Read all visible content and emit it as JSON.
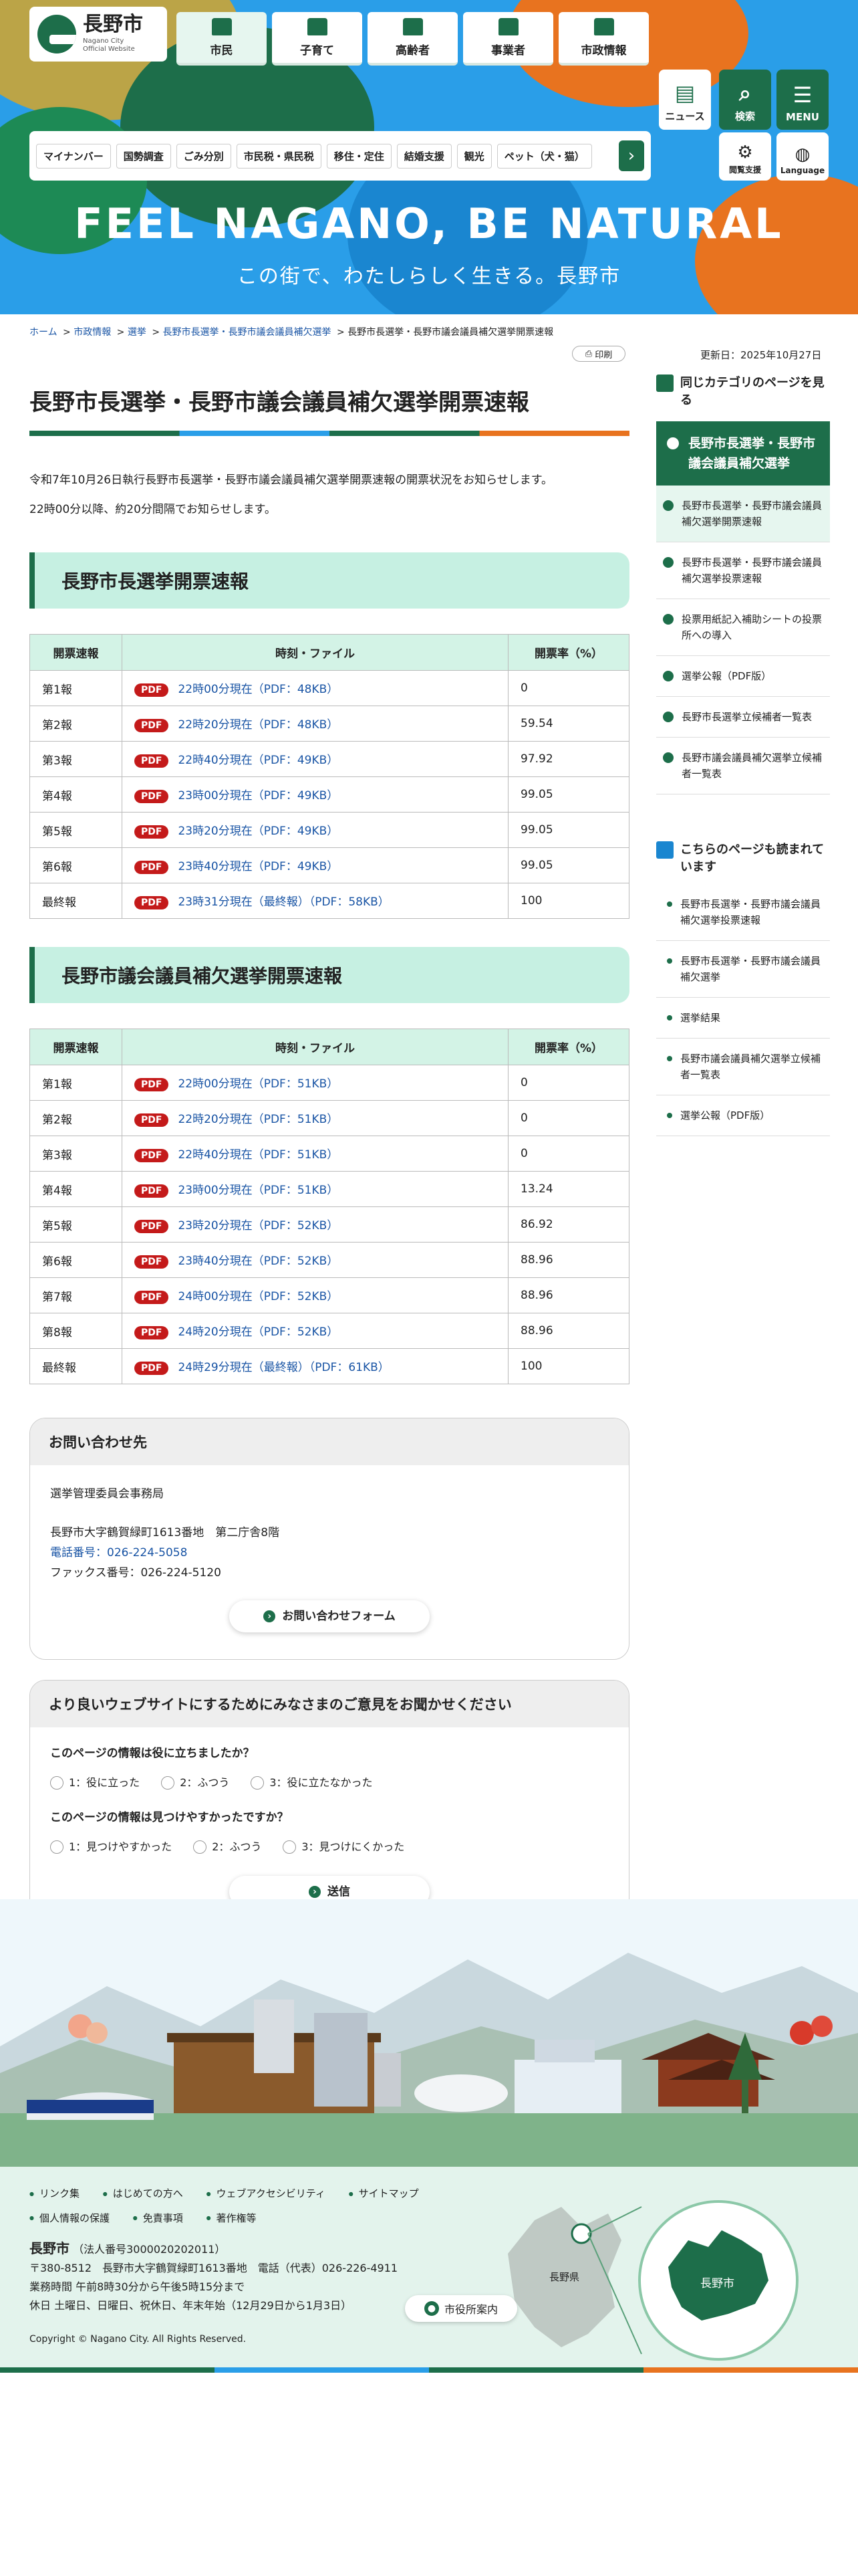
{
  "header": {
    "logo_jp": "長野市",
    "logo_en1": "Nagano City",
    "logo_en2": "Official Website",
    "nav": [
      {
        "label": "市民"
      },
      {
        "label": "子育て"
      },
      {
        "label": "高齢者"
      },
      {
        "label": "事業者"
      },
      {
        "label": "市政情報"
      }
    ],
    "tools": {
      "news": "ニュース",
      "search": "検索",
      "menu": "MENU",
      "browse": "閲覧支援",
      "language": "Language"
    },
    "tags": [
      "マイナンバー",
      "国勢調査",
      "ごみ分別",
      "市民税・県民税",
      "移住・定住",
      "結婚支援",
      "観光",
      "ペット（犬・猫）"
    ],
    "catch_en": "FEEL NAGANO, BE NATURAL",
    "catch_jp": "この街で、わたしらしく生きる。長野市"
  },
  "breadcrumb": {
    "items": [
      "ホーム",
      "市政情報",
      "選挙",
      "長野市長選挙・長野市議会議員補欠選挙"
    ],
    "current": "長野市長選挙・長野市議会議員補欠選挙開票速報"
  },
  "print_label": "印刷",
  "updated": "更新日：2025年10月27日",
  "page": {
    "title": "長野市長選挙・長野市議会議員補欠選挙開票速報",
    "lead1": "令和7年10月26日執行長野市長選挙・長野市議会議員補欠選挙開票速報の開票状況をお知らせします。",
    "lead2": "22時00分以降、約20分間隔でお知らせします。"
  },
  "table_headers": {
    "col1": "開票速報",
    "col2": "時刻・ファイル",
    "col3": "開票率（%）"
  },
  "pdf_badge": "PDF",
  "mayor": {
    "heading": "長野市長選挙開票速報",
    "rows": [
      {
        "label": "第1報",
        "file": "22時00分現在（PDF：48KB）",
        "rate": "0"
      },
      {
        "label": "第2報",
        "file": "22時20分現在（PDF：48KB）",
        "rate": "59.54"
      },
      {
        "label": "第3報",
        "file": "22時40分現在（PDF：49KB）",
        "rate": "97.92"
      },
      {
        "label": "第4報",
        "file": "23時00分現在（PDF：49KB）",
        "rate": "99.05"
      },
      {
        "label": "第5報",
        "file": "23時20分現在（PDF：49KB）",
        "rate": "99.05"
      },
      {
        "label": "第6報",
        "file": "23時40分現在（PDF：49KB）",
        "rate": "99.05"
      },
      {
        "label": "最終報",
        "file": "23時31分現在（最終報）（PDF：58KB）",
        "rate": "100"
      }
    ]
  },
  "council": {
    "heading": "長野市議会議員補欠選挙開票速報",
    "rows": [
      {
        "label": "第1報",
        "file": "22時00分現在（PDF：51KB）",
        "rate": "0"
      },
      {
        "label": "第2報",
        "file": "22時20分現在（PDF：51KB）",
        "rate": "0"
      },
      {
        "label": "第3報",
        "file": "22時40分現在（PDF：51KB）",
        "rate": "0"
      },
      {
        "label": "第4報",
        "file": "23時00分現在（PDF：51KB）",
        "rate": "13.24"
      },
      {
        "label": "第5報",
        "file": "23時20分現在（PDF：52KB）",
        "rate": "86.92"
      },
      {
        "label": "第6報",
        "file": "23時40分現在（PDF：52KB）",
        "rate": "88.96"
      },
      {
        "label": "第7報",
        "file": "24時00分現在（PDF：52KB）",
        "rate": "88.96"
      },
      {
        "label": "第8報",
        "file": "24時20分現在（PDF：52KB）",
        "rate": "88.96"
      },
      {
        "label": "最終報",
        "file": "24時29分現在（最終報）（PDF：61KB）",
        "rate": "100"
      }
    ]
  },
  "contact": {
    "heading": "お問い合わせ先",
    "dept": "選挙管理委員会事務局",
    "address": "長野市大字鶴賀緑町1613番地　第二庁舎8階",
    "phone": "電話番号：026-224-5058",
    "fax": "ファックス番号：026-224-5120",
    "form_button": "お問い合わせフォーム"
  },
  "feedback": {
    "heading": "より良いウェブサイトにするためにみなさまのご意見をお聞かせください",
    "q1": "このページの情報は役に立ちましたか？",
    "q1_options": [
      "1：役に立った",
      "2：ふつう",
      "3：役に立たなかった"
    ],
    "q2": "このページの情報は見つけやすかったですか？",
    "q2_options": [
      "1：見つけやすかった",
      "2：ふつう",
      "3：見つけにくかった"
    ],
    "submit": "送信"
  },
  "sidebar": {
    "same_heading": "同じカテゴリのページを見る",
    "current": "長野市長選挙・長野市議会議員補欠選挙",
    "same_items": [
      "長野市長選挙・長野市議会議員補欠選挙開票速報",
      "長野市長選挙・長野市議会議員補欠選挙投票速報",
      "投票用紙記入補助シートの投票所への導入",
      "選挙公報（PDF版）",
      "長野市長選挙立候補者一覧表",
      "長野市議会議員補欠選挙立候補者一覧表"
    ],
    "also_heading": "こちらのページも読まれています",
    "also_items": [
      "長野市長選挙・長野市議会議員補欠選挙投票速報",
      "長野市長選挙・長野市議会議員補欠選挙",
      "選挙結果",
      "長野市議会議員補欠選挙立候補者一覧表",
      "選挙公報（PDF版）"
    ]
  },
  "footer": {
    "links": [
      "リンク集",
      "はじめての方へ",
      "ウェブアクセシビリティ",
      "サイトマップ",
      "個人情報の保護",
      "免責事項",
      "著作権等"
    ],
    "name": "長野市",
    "corp_no": "（法人番号3000020202011）",
    "address": "〒380-8512　長野市大字鶴賀緑町1613番地　電話（代表）026-226-4911",
    "hours": "業務時間 午前8時30分から午後5時15分まで",
    "holidays": "休日 土曜日、日曜日、祝休日、年末年始（12月29日から1月3日）",
    "guide_button": "市役所案内",
    "map_pref": "長野県",
    "map_city": "長野市",
    "copyright": "Copyright © Nagano City. All Rights Reserved."
  },
  "colors": {
    "brand_green": "#1d6e4a",
    "sky": "#2a9ee8",
    "mint": "#c6f0e2",
    "pdf_red": "#c41a1a",
    "accent_orange": "#e8731f"
  }
}
